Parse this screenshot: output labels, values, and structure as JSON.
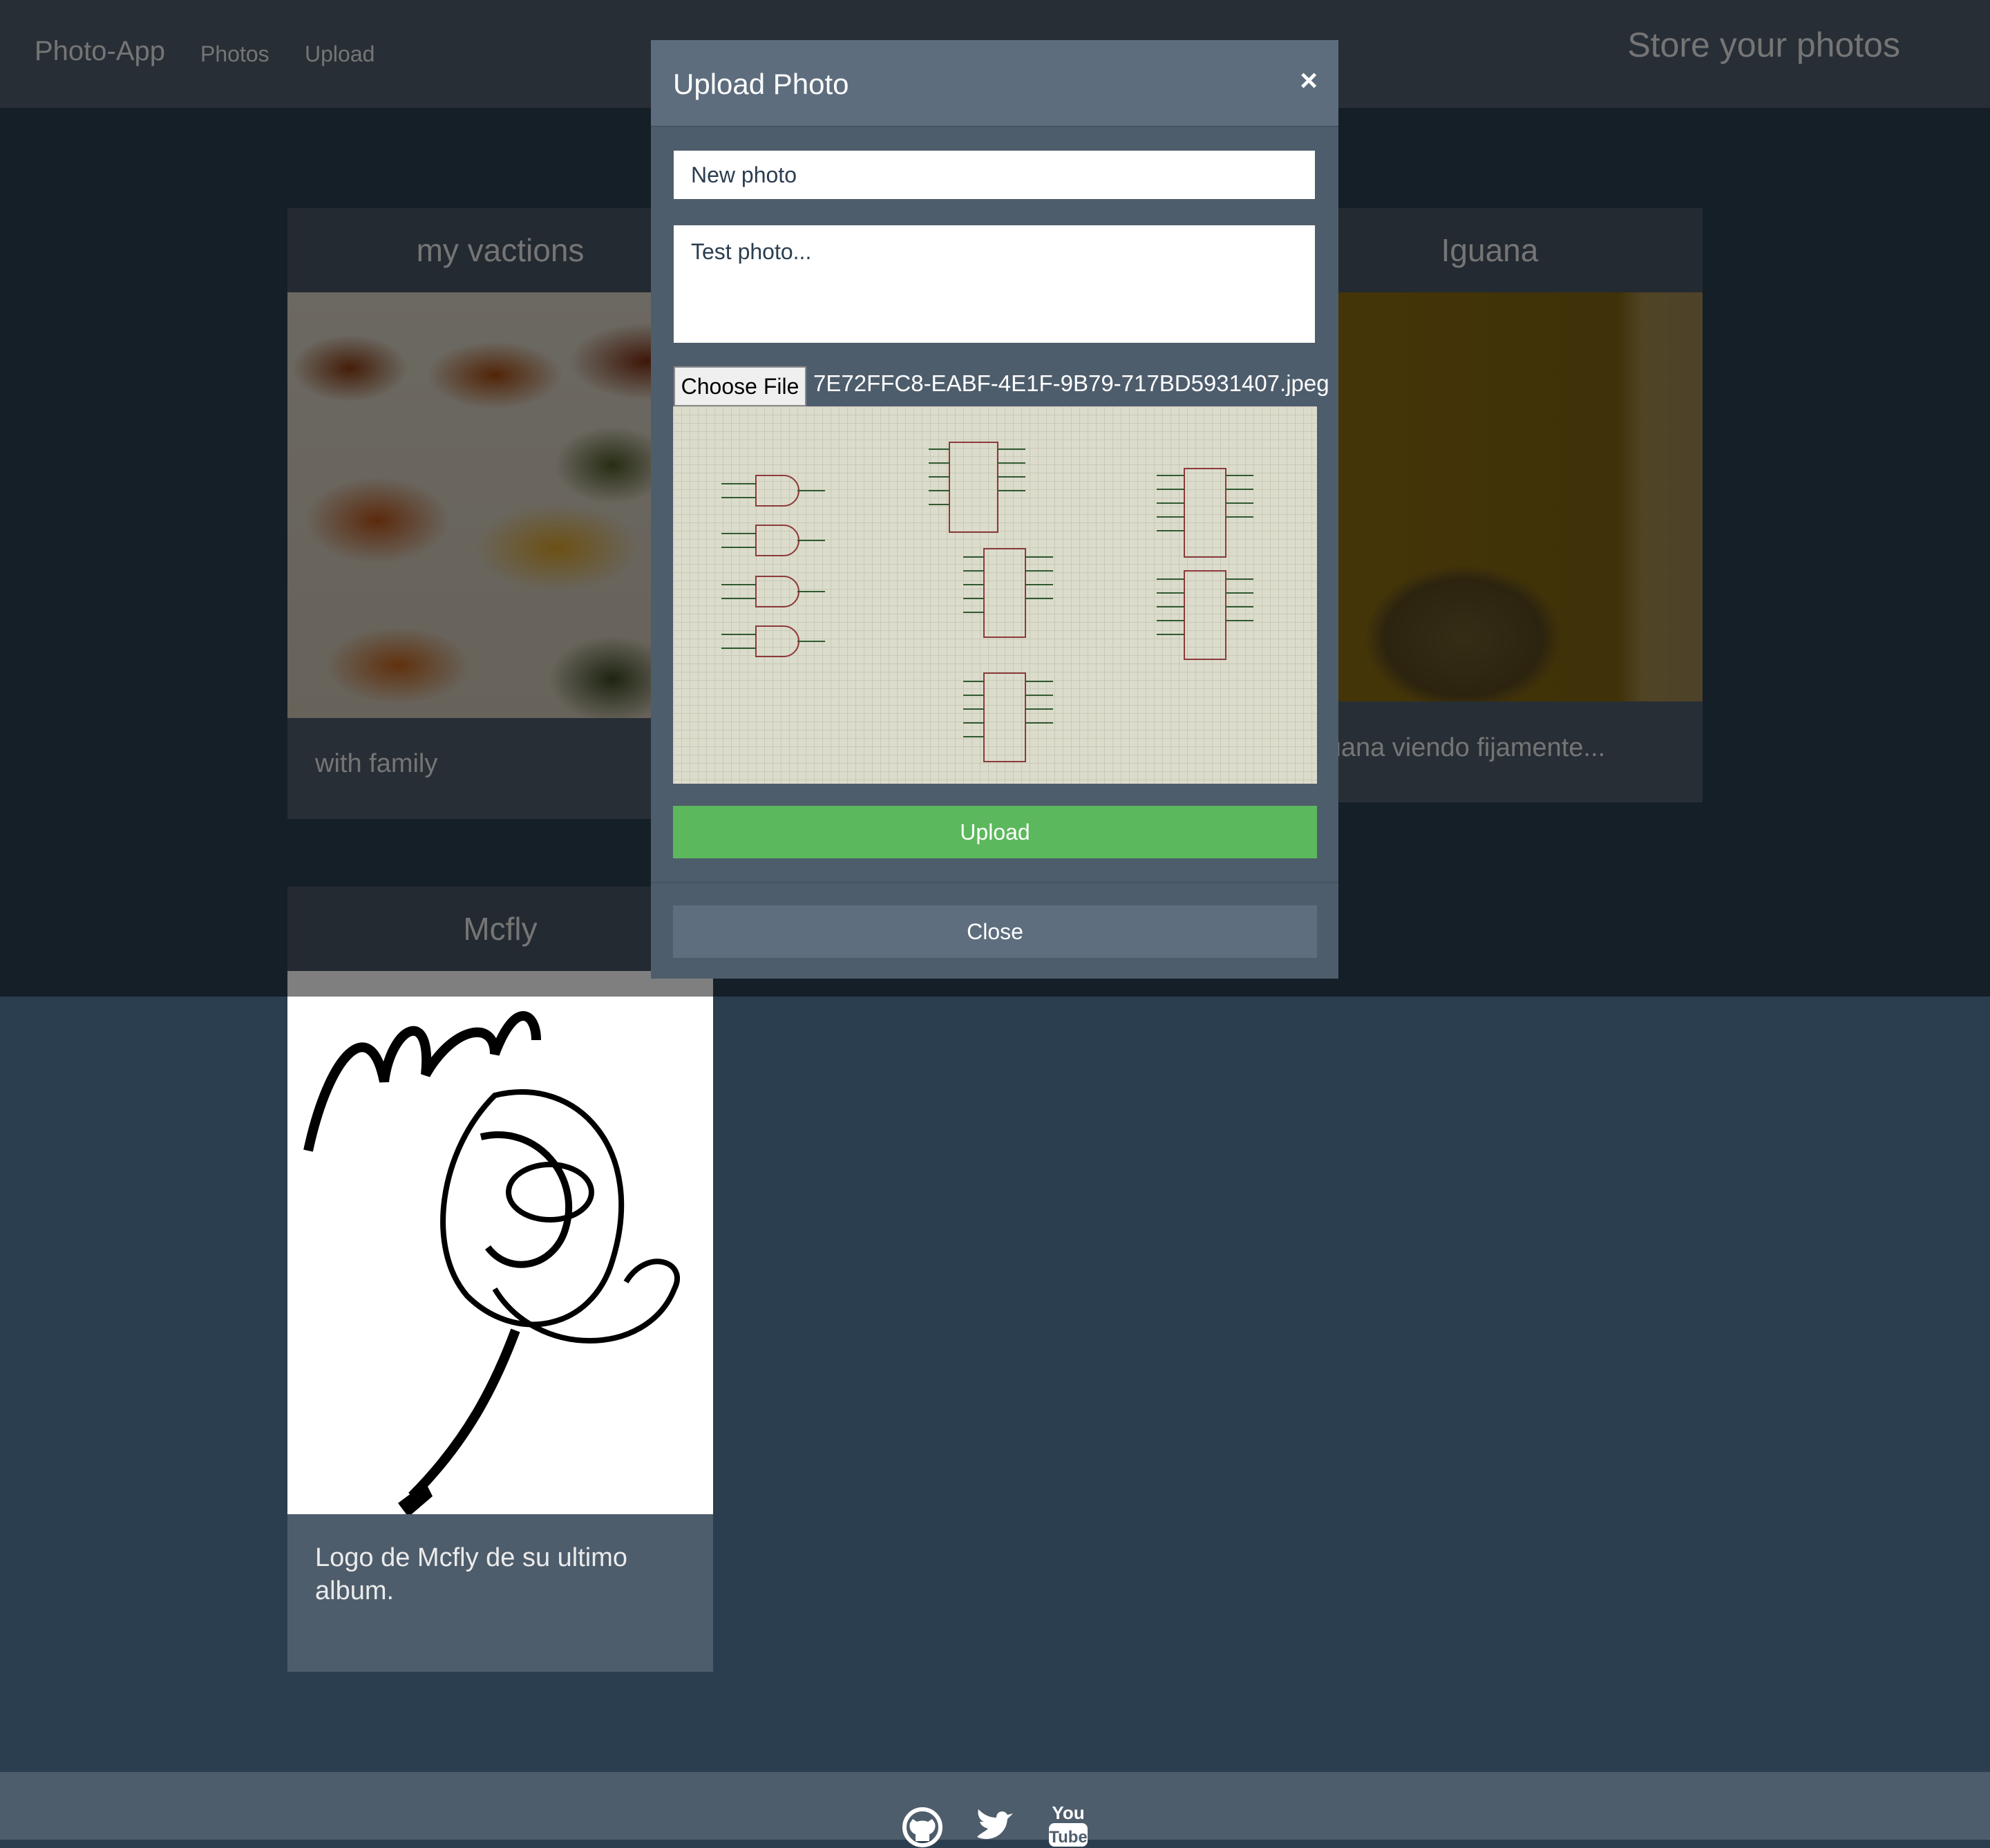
{
  "navbar": {
    "brand": "Photo-App",
    "links": [
      "Photos",
      "Upload"
    ],
    "tagline": "Store your photos"
  },
  "photos": [
    {
      "title": "my vactions",
      "description": "with family",
      "image": "food-photo"
    },
    {
      "title": "Iguana",
      "description": "Iguana viendo fijamente...",
      "image": "iguana-photo"
    },
    {
      "title": "Mcfly",
      "description": "Logo de Mcfly de su ultimo album.",
      "image": "mcfly-logo"
    }
  ],
  "modal": {
    "title": "Upload Photo",
    "close_symbol": "×",
    "title_value": "New photo",
    "description_value": "Test photo...",
    "file_button": "Choose File",
    "file_name": "7E72FFC8-EABF-4E1F-9B79-717BD5931407.jpeg",
    "upload_label": "Upload",
    "close_label": "Close"
  },
  "footer": {
    "icons": [
      "github-icon",
      "twitter-icon",
      "youtube-icon"
    ],
    "youtube_text": "You Tube"
  },
  "colors": {
    "page_bg": "#2b3e50",
    "navbar_bg": "#4e5d6c",
    "upload_button": "#5cb85c",
    "modal_header": "#5d6d7e"
  }
}
